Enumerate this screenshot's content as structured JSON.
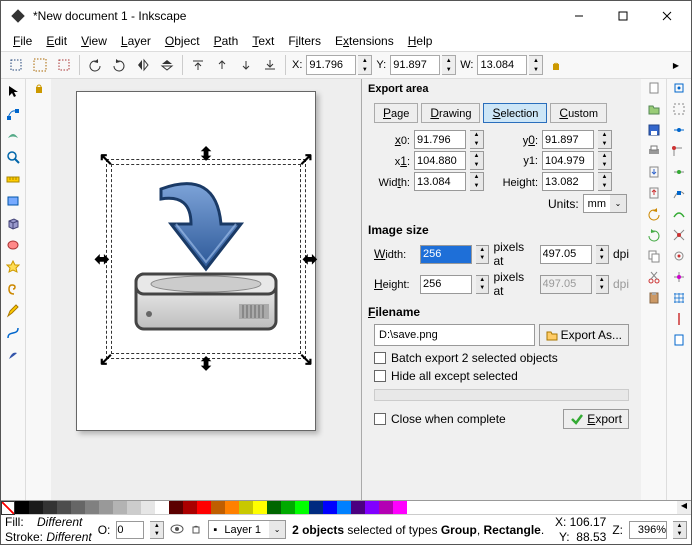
{
  "title": "*New document 1 - Inkscape",
  "menu": [
    "File",
    "Edit",
    "View",
    "Layer",
    "Object",
    "Path",
    "Text",
    "Filters",
    "Extensions",
    "Help"
  ],
  "menu_keys": [
    "F",
    "E",
    "V",
    "L",
    "O",
    "P",
    "T",
    "i",
    "x",
    "H"
  ],
  "toolbar": {
    "x_label": "X:",
    "x": "91.796",
    "y_label": "Y:",
    "y": "91.897",
    "w_label": "W:",
    "w": "13.084"
  },
  "export": {
    "area_legend": "Export area",
    "tabs": {
      "page": "Page",
      "drawing": "Drawing",
      "selection": "Selection",
      "custom": "Custom"
    },
    "x0_lbl": "x0:",
    "x0": "91.796",
    "y0_lbl": "y0:",
    "y0": "91.897",
    "x1_lbl": "x1:",
    "x1": "104.880",
    "y1_lbl": "y1:",
    "y1": "104.979",
    "w_lbl": "Width:",
    "w": "13.084",
    "h_lbl": "Height:",
    "h": "13.082",
    "units_lbl": "Units:",
    "units": "mm",
    "img_legend": "Image size",
    "iw_lbl": "Width:",
    "iw": "256",
    "pixels_at1": "pixels at",
    "dpi1": "497.05",
    "dpi1_lbl": "dpi",
    "ih_lbl": "Height:",
    "ih": "256",
    "pixels_at2": "pixels at",
    "dpi2": "497.05",
    "dpi2_lbl": "dpi",
    "file_legend": "Filename",
    "file": "D:\\save.png",
    "export_as": "Export As...",
    "batch": "Batch export 2 selected objects",
    "hide": "Hide all except selected",
    "close": "Close when complete",
    "export_btn": "Export"
  },
  "status": {
    "fill_lbl": "Fill:",
    "fill": "Different",
    "stroke_lbl": "Stroke:",
    "stroke": "Different",
    "o_lbl": "O:",
    "o": "0",
    "layer": "Layer 1",
    "msg": "2 objects selected of types Group, Rectangle.",
    "x_lbl": "X:",
    "x": "106.17",
    "y_lbl": "Y:",
    "y": "88.53",
    "z_lbl": "Z:",
    "z": "396%"
  },
  "palette_colors": [
    "#000000",
    "#1a1a1a",
    "#333333",
    "#4d4d4d",
    "#666666",
    "#808080",
    "#999999",
    "#b3b3b3",
    "#cccccc",
    "#e6e6e6",
    "#ffffff",
    "#5b0000",
    "#aa0000",
    "#ff0000",
    "#c05e00",
    "#ff8000",
    "#c8c800",
    "#ffff00",
    "#006600",
    "#00aa00",
    "#00ff00",
    "#002b80",
    "#0000ff",
    "#0080ff",
    "#4b0080",
    "#8000ff",
    "#b300b3",
    "#ff00ff"
  ]
}
